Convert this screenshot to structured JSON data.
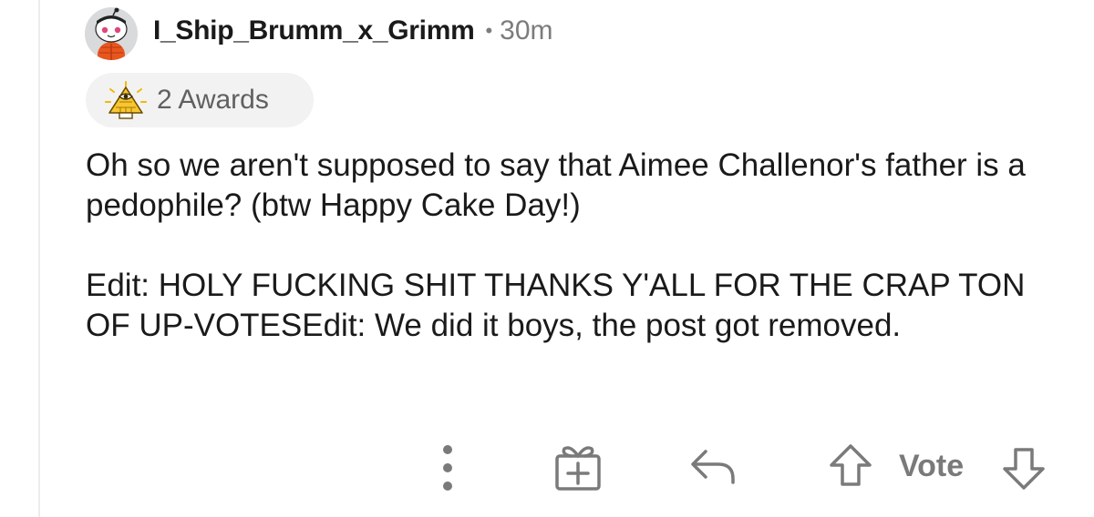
{
  "comment": {
    "author": {
      "username": "I_Ship_Brumm_x_Grimm",
      "avatar_icon": "snoo-avatar-icon"
    },
    "separator": "•",
    "age": "30m",
    "awards": {
      "icon": "illuminati-award-icon",
      "label": "2 Awards"
    },
    "body": {
      "paragraph_1": "Oh so we aren't supposed to say that Aimee Challenor's father is a pedophile? (btw Happy Cake Day!)",
      "paragraph_2": "Edit: HOLY FUCKING SHIT THANKS Y'ALL FOR THE CRAP TON OF UP-VOTESEdit: We did it boys, the post got removed."
    }
  },
  "actions": {
    "more_icon": "more-vertical-icon",
    "award_icon": "gift-icon",
    "reply_icon": "reply-icon",
    "upvote_icon": "upvote-arrow-icon",
    "vote_label": "Vote",
    "downvote_icon": "downvote-arrow-icon"
  },
  "colors": {
    "text": "#1a1a1b",
    "meta": "#7c7c7c",
    "icon": "#7a7a7a",
    "award_pill_bg": "#f2f2f2"
  }
}
